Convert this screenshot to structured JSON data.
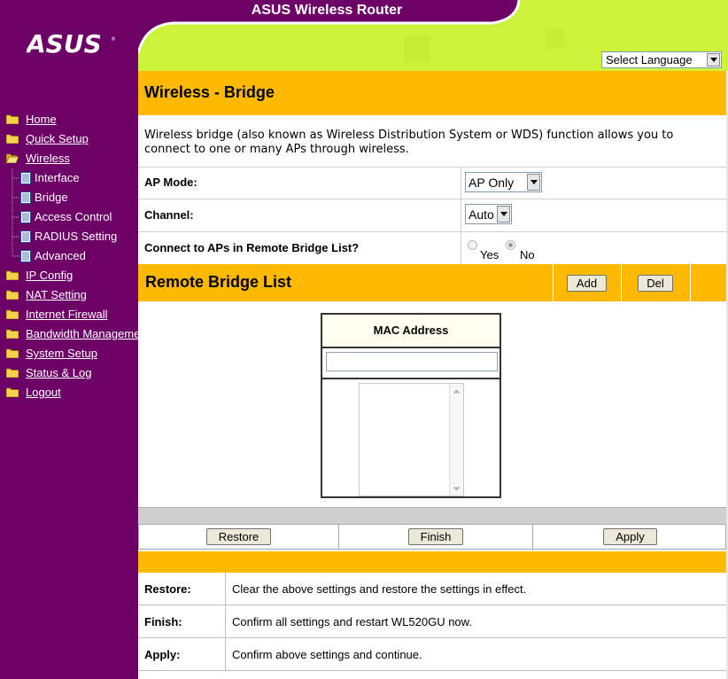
{
  "app_title": "ASUS Wireless Router",
  "logo_text": "ASUS",
  "language_select": {
    "selected": "Select Language"
  },
  "sidebar": {
    "items": [
      {
        "label": "Home",
        "icon": "folder-icon",
        "level": 0
      },
      {
        "label": "Quick Setup",
        "icon": "folder-icon",
        "level": 0
      },
      {
        "label": "Wireless",
        "icon": "folder-open-icon",
        "level": 0
      },
      {
        "label": "Interface",
        "icon": "page-icon",
        "level": 1
      },
      {
        "label": "Bridge",
        "icon": "page-icon",
        "level": 1
      },
      {
        "label": "Access Control",
        "icon": "page-icon",
        "level": 1
      },
      {
        "label": "RADIUS Setting",
        "icon": "page-icon",
        "level": 1
      },
      {
        "label": "Advanced",
        "icon": "page-icon",
        "level": 1
      },
      {
        "label": "IP Config",
        "icon": "folder-icon",
        "level": 0
      },
      {
        "label": "NAT Setting",
        "icon": "folder-icon",
        "level": 0
      },
      {
        "label": "Internet Firewall",
        "icon": "folder-icon",
        "level": 0
      },
      {
        "label": "Bandwidth Management",
        "icon": "folder-icon",
        "level": 0
      },
      {
        "label": "System Setup",
        "icon": "folder-icon",
        "level": 0
      },
      {
        "label": "Status & Log",
        "icon": "folder-icon",
        "level": 0
      },
      {
        "label": "Logout",
        "icon": "folder-icon",
        "level": 0
      }
    ]
  },
  "page": {
    "title": "Wireless - Bridge",
    "description": "Wireless bridge (also known as Wireless Distribution System or WDS) function allows you to connect to one or many APs through wireless."
  },
  "form": {
    "ap_mode": {
      "label": "AP Mode:",
      "value": "AP Only"
    },
    "channel": {
      "label": "Channel:",
      "value": "Auto"
    },
    "connect": {
      "label": "Connect to APs in Remote Bridge List?",
      "yes": "Yes",
      "no": "No",
      "selected": "No"
    }
  },
  "remote_bridge": {
    "title": "Remote Bridge List",
    "add": "Add",
    "del": "Del",
    "column": "MAC Address",
    "input_value": "",
    "entries": []
  },
  "actions": {
    "restore": "Restore",
    "finish": "Finish",
    "apply": "Apply"
  },
  "help": [
    {
      "key": "Restore:",
      "text": "Clear the above settings and restore the settings in effect."
    },
    {
      "key": "Finish:",
      "text": "Confirm all settings and restart WL520GU now."
    },
    {
      "key": "Apply:",
      "text": "Confirm above settings and continue."
    }
  ],
  "colors": {
    "sidebar": "#6c0066",
    "header": "#cdf23c",
    "accent": "#ffb900"
  }
}
